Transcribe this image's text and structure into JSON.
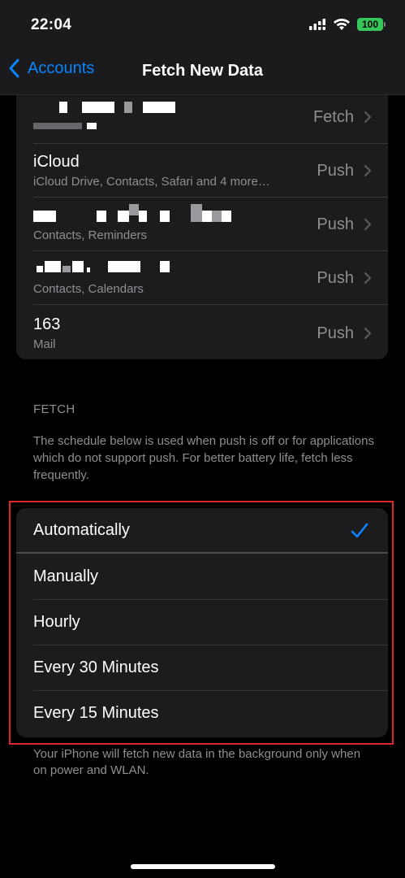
{
  "status_bar": {
    "time": "22:04",
    "battery": "100",
    "icons": [
      "signal-icon",
      "wifi-icon",
      "battery-icon"
    ]
  },
  "nav": {
    "back_label": "Accounts",
    "title": "Fetch New Data"
  },
  "accounts": [
    {
      "title": "",
      "subtitle": "",
      "value": "Fetch",
      "redacted": true
    },
    {
      "title": "iCloud",
      "subtitle": "iCloud Drive, Contacts, Safari and 4 more…",
      "value": "Push",
      "redacted": false
    },
    {
      "title": "",
      "subtitle": "Contacts, Reminders",
      "value": "Push",
      "redacted": true
    },
    {
      "title": "",
      "subtitle": "Contacts, Calendars",
      "value": "Push",
      "redacted": true
    },
    {
      "title": "163",
      "subtitle": "Mail",
      "value": "Push",
      "redacted": false
    }
  ],
  "fetch_section": {
    "header": "FETCH",
    "description": "The schedule below is used when push is off or for applications which do not support push. For better battery life, fetch less frequently.",
    "options": [
      {
        "label": "Automatically",
        "selected": true
      },
      {
        "label": "Manually",
        "selected": false
      },
      {
        "label": "Hourly",
        "selected": false
      },
      {
        "label": "Every 30 Minutes",
        "selected": false
      },
      {
        "label": "Every 15 Minutes",
        "selected": false
      }
    ],
    "footer": "Your iPhone will fetch new data in the background only when on power and WLAN."
  },
  "colors": {
    "accent": "#0a84ff",
    "highlight": "#e0262c",
    "battery": "#35c759"
  }
}
